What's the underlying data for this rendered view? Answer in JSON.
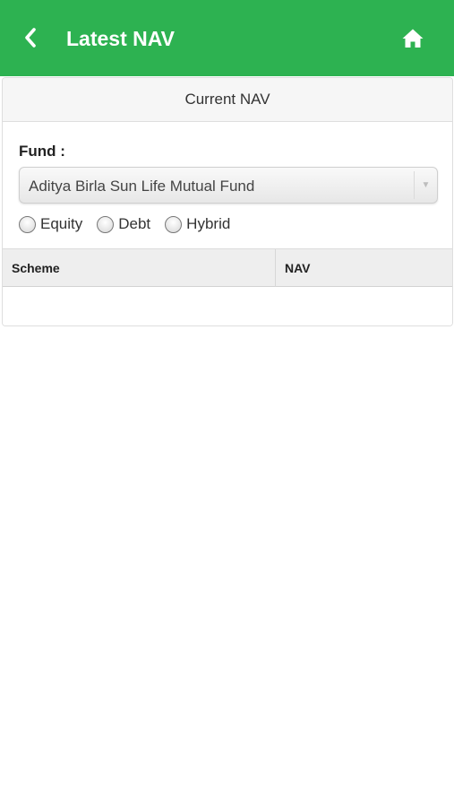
{
  "header": {
    "title": "Latest NAV",
    "back_icon": "chevron-left-icon",
    "home_icon": "home-icon",
    "background_color": "#2db251",
    "text_color": "#ffffff"
  },
  "card": {
    "title": "Current NAV"
  },
  "fund": {
    "label": "Fund :",
    "selected": "Aditya Birla Sun Life Mutual Fund",
    "dropdown_icon": "triangle-down-icon"
  },
  "category_options": [
    {
      "label": "Equity",
      "checked": false
    },
    {
      "label": "Debt",
      "checked": false
    },
    {
      "label": "Hybrid",
      "checked": false
    }
  ],
  "table": {
    "columns": [
      "Scheme",
      "NAV"
    ],
    "rows": []
  }
}
